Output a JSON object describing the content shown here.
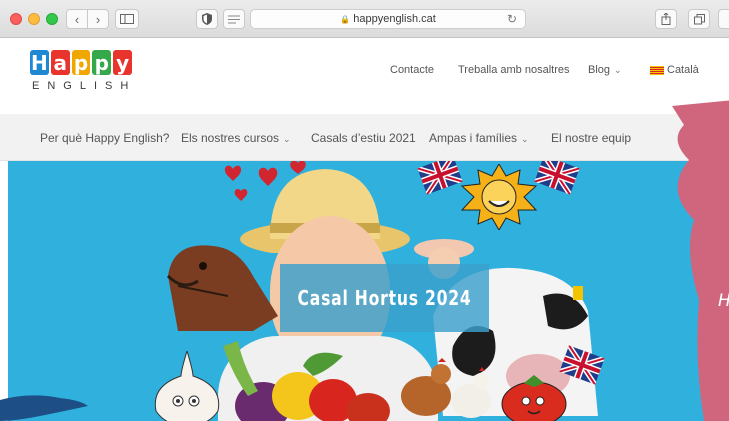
{
  "browser": {
    "url": "happyenglish.cat",
    "lock_icon": "🔒"
  },
  "header": {
    "logo_letters": [
      "H",
      "a",
      "p",
      "p",
      "y"
    ],
    "logo_colors": [
      "#1e88d3",
      "#e8342c",
      "#f0a800",
      "#35a84a",
      "#e8342c"
    ],
    "logo_subtitle": "ENGLISH",
    "top_nav": {
      "contacte": "Contacte",
      "treballa": "Treballa amb nosaltres",
      "blog": "Blog",
      "language": "Català"
    }
  },
  "main_nav": {
    "items": [
      {
        "label": "Per què Happy English?",
        "dropdown": false
      },
      {
        "label": "Els nostres cursos",
        "dropdown": true
      },
      {
        "label": "Casals d’estiu 2021",
        "dropdown": false
      },
      {
        "label": "Ampas i famílies",
        "dropdown": true
      },
      {
        "label": "El nostre equip",
        "dropdown": false
      }
    ]
  },
  "hero": {
    "title": "Casal Hortus 2024",
    "side_text": "H",
    "background_color": "#2fb0dd"
  }
}
